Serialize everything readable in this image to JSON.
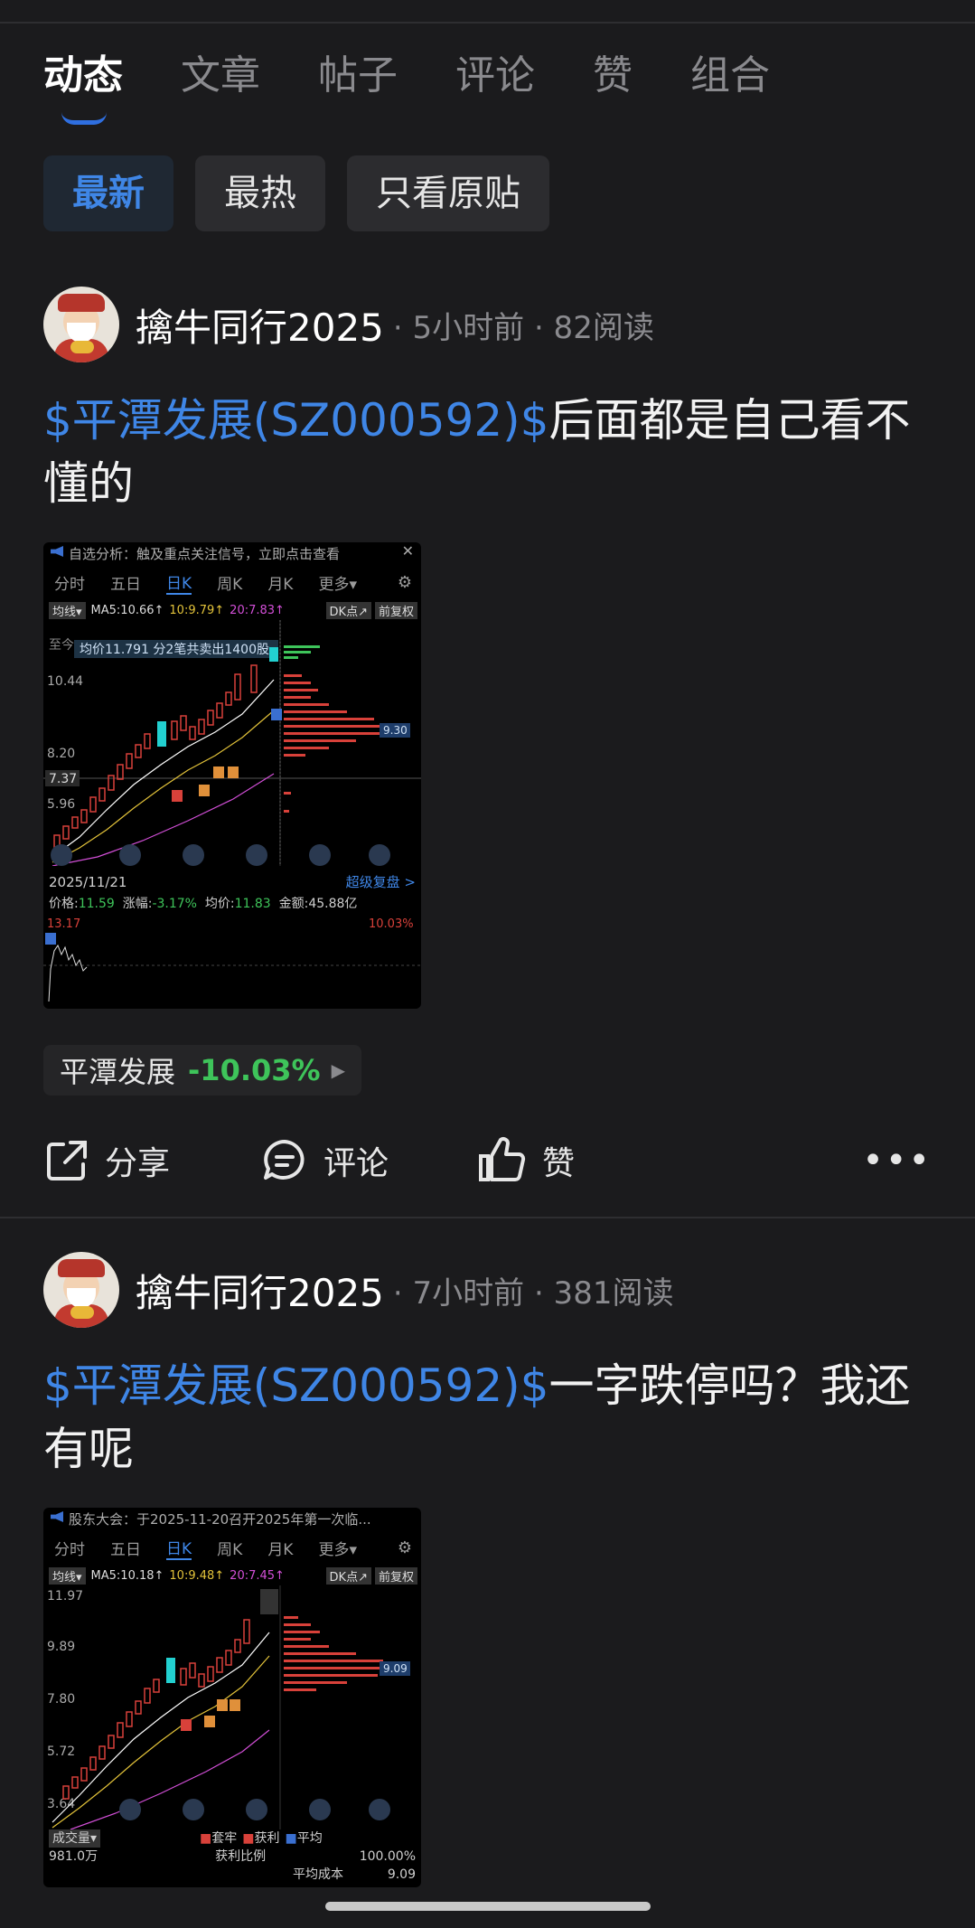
{
  "tabs": [
    "动态",
    "文章",
    "帖子",
    "评论",
    "赞",
    "组合"
  ],
  "filters": [
    "最新",
    "最热",
    "只看原贴"
  ],
  "posts": [
    {
      "author": "擒牛同行2025",
      "time": "· 5小时前 · 82阅读",
      "stock_tag": "$平潭发展(SZ000592)$",
      "text": "后面都是自己看不懂的",
      "chart": {
        "banner": "自选分析：触及重点关注信号，立即点击查看",
        "tabs": [
          "分时",
          "五日",
          "日K",
          "周K",
          "月K",
          "更多▾"
        ],
        "ma_label": "均线▾",
        "ma5": "MA5:10.66↑",
        "ma10": "10:9.79↑",
        "ma20": "20:7.83↑",
        "dk": "DK点↗",
        "fuquan": "前复权",
        "popup": "均价11.791  分2笔共卖出1400股",
        "popup_prefix": "至今",
        "prices": [
          "10.44",
          "8.20",
          "7.37",
          "5.96"
        ],
        "cost_label": "9.30",
        "date": "2025/11/21",
        "replay": "超级复盘 >",
        "price_label": "价格:",
        "price": "11.59",
        "change_label": "涨幅:",
        "change": "-3.17%",
        "avg_label": "均价:",
        "avg": "11.83",
        "amount_label": "金额:",
        "amount": "45.88亿",
        "intraday_high": "13.17",
        "intraday_pct": "10.03%"
      },
      "chip_name": "平潭发展",
      "chip_change": "-10.03%"
    },
    {
      "author": "擒牛同行2025",
      "time": "· 7小时前 · 381阅读",
      "stock_tag": "$平潭发展(SZ000592)$",
      "text": "一字跌停吗？我还有呢",
      "chart": {
        "banner": "股东大会：于2025-11-20召开2025年第一次临...",
        "tabs": [
          "分时",
          "五日",
          "日K",
          "周K",
          "月K",
          "更多▾"
        ],
        "ma_label": "均线▾",
        "ma5": "MA5:10.18↑",
        "ma10": "10:9.48↑",
        "ma20": "20:7.45↑",
        "dk": "DK点↗",
        "fuquan": "前复权",
        "prices": [
          "11.97",
          "9.89",
          "7.80",
          "5.72",
          "3.64"
        ],
        "cost_label": "9.09",
        "volume_label": "成交量▾",
        "volume_value": "981.0万",
        "profit_ratio_label": "获利比例",
        "profit_ratio": "100.00%",
        "avg_cost_label": "平均成本",
        "avg_cost": "9.09",
        "legend": [
          "套牢",
          "获利",
          "平均"
        ]
      }
    }
  ],
  "actions": {
    "share": "分享",
    "comment": "评论",
    "like": "赞",
    "more": "•••"
  },
  "colors": {
    "accent": "#3f86e6",
    "down": "#3ec45a",
    "up": "#d8413a",
    "bg": "#1b1b1d"
  }
}
